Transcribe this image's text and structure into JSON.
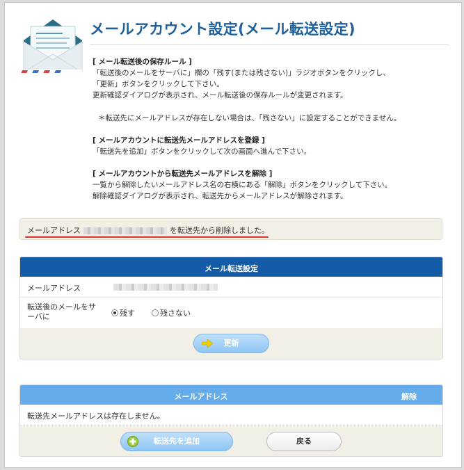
{
  "header": {
    "title": "メールアカウント設定(メール転送設定)"
  },
  "info": {
    "section1_heading": "[ メール転送後の保存ルール ]",
    "section1_line1": "「転送後のメールをサーバに」欄の「残す(または残さない)」ラジオボタンをクリックし、",
    "section1_line2": "「更新」ボタンをクリックして下さい。",
    "section1_line3": "更新確認ダイアログが表示され、メール転送後の保存ルールが変更されます。",
    "note": "＊転送先にメールアドレスが存在しない場合は、「残さない」に設定することができません。",
    "section2_heading": "[ メールアカウントに転送先メールアドレスを登録 ]",
    "section2_line1": "「転送先を追加」ボタンをクリックして次の画面へ進んで下さい。",
    "section3_heading": "[ メールアカウントから転送先メールアドレスを解除 ]",
    "section3_line1": "一覧から解除したいメールアドレス名の右横にある「解除」ボタンをクリックして下さい。",
    "section3_line2": "解除確認ダイアログが表示され、転送先からメールアドレスが解除されます。"
  },
  "message": {
    "prefix": "メールアドレス",
    "suffix": "を転送先から削除しました。"
  },
  "forward_settings": {
    "title": "メール転送設定",
    "email_label": "メールアドレス",
    "keep_label_line1": "転送後のメールをサ",
    "keep_label_line2": "ーバに",
    "option_keep": "残す",
    "option_discard": "残さない",
    "selected": "残す",
    "update_button": "更新"
  },
  "forward_list": {
    "col_email": "メールアドレス",
    "col_remove": "解除",
    "empty_text": "転送先メールアドレスは存在しません。",
    "add_button": "転送先を追加",
    "back_button": "戻る"
  }
}
